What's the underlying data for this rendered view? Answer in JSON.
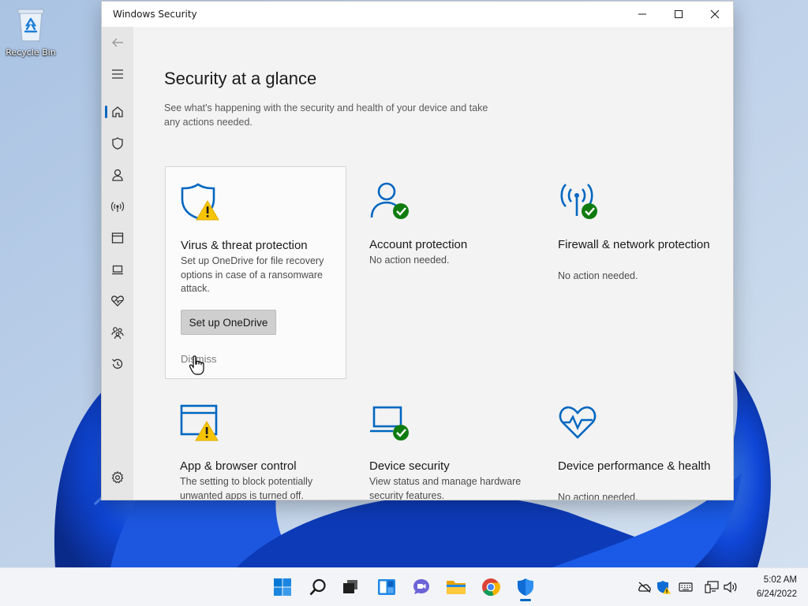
{
  "desktop": {
    "recycle_bin_label": "Recycle Bin"
  },
  "window": {
    "title": "Windows Security",
    "controls": [
      "minimize",
      "maximize",
      "close"
    ]
  },
  "nav": {
    "items": [
      {
        "name": "back-icon"
      },
      {
        "name": "hamburger-menu-icon"
      },
      {
        "name": "home-icon",
        "active": true
      },
      {
        "name": "shield-icon"
      },
      {
        "name": "person-icon"
      },
      {
        "name": "wifi-icon"
      },
      {
        "name": "browser-window-icon"
      },
      {
        "name": "laptop-icon"
      },
      {
        "name": "heart-health-icon"
      },
      {
        "name": "family-icon"
      },
      {
        "name": "history-icon"
      },
      {
        "name": "settings-gear-icon"
      }
    ]
  },
  "page": {
    "title": "Security at a glance",
    "subtitle": "See what's happening with the security and health of your device and take any actions needed."
  },
  "cards": [
    {
      "title": "Virus & threat protection",
      "desc": "Set up OneDrive for file recovery options in case of a ransomware attack.",
      "button": "Set up OneDrive",
      "dismiss": "Dismiss",
      "status": "warning",
      "icon": "shield-icon"
    },
    {
      "title": "Account protection",
      "desc": "No action needed.",
      "status": "ok",
      "icon": "person-icon"
    },
    {
      "title": "Firewall & network protection",
      "desc": "No action needed.",
      "status": "ok",
      "icon": "wifi-icon"
    },
    {
      "title": "App & browser control",
      "desc": "The setting to block potentially unwanted apps is turned off.",
      "status": "warning",
      "icon": "browser-window-icon"
    },
    {
      "title": "Device security",
      "desc": "View status and manage hardware security features.",
      "status": "ok",
      "icon": "laptop-icon"
    },
    {
      "title": "Device performance & health",
      "desc": "No action needed.",
      "status": "ok",
      "icon": "heart-health-icon"
    }
  ],
  "colors": {
    "accent": "#0067c0",
    "ok": "#107c10",
    "warning": "#f7c400"
  },
  "taskbar": {
    "apps": [
      "start",
      "search",
      "task-view",
      "widgets",
      "chat",
      "file-explorer",
      "chrome",
      "windows-security"
    ],
    "time": "5:02 AM",
    "date": "6/24/2022"
  }
}
